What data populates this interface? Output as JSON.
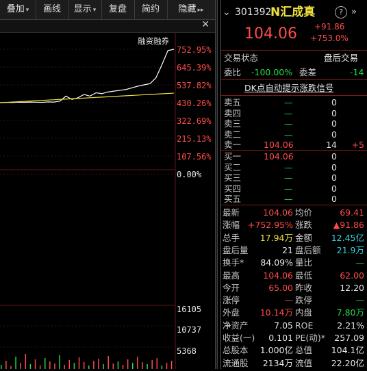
{
  "toolbar": {
    "items": [
      {
        "label": "叠加",
        "caret": "▾"
      },
      {
        "label": "画线",
        "caret": ""
      },
      {
        "label": "显示",
        "caret": "▾"
      },
      {
        "label": "复盘",
        "caret": ""
      },
      {
        "label": "简约",
        "caret": ""
      },
      {
        "label": "隐藏",
        "caret": "▸▸"
      }
    ],
    "close": "✕"
  },
  "chart": {
    "legend": "融资融券",
    "price_labels": [
      "752.95%",
      "645.39%",
      "537.82%",
      "430.26%",
      "322.69%",
      "215.13%",
      "107.56%",
      "0.00%"
    ],
    "volume_labels": [
      "16105",
      "10737",
      "5368"
    ]
  },
  "chart_data": {
    "type": "line",
    "series": [
      {
        "values": [
          430.3,
          432,
          431,
          433,
          432,
          434,
          433,
          432,
          435,
          434,
          440,
          470,
          450,
          460,
          480,
          470,
          490,
          485,
          495,
          500,
          505,
          510,
          520,
          530,
          537.8,
          545,
          580,
          660,
          745,
          752.95
        ]
      },
      {
        "values": [
          430.3,
          432,
          434,
          436,
          438,
          440,
          442,
          444,
          446,
          448,
          450,
          452,
          454,
          456,
          458,
          460,
          462,
          464,
          466,
          468,
          470,
          472,
          474,
          476,
          478,
          480,
          482,
          484,
          486,
          488
        ]
      }
    ],
    "ylim": [
      0,
      752.95
    ]
  },
  "quote": {
    "code": "301392",
    "name": "N汇成真",
    "price": "104.06",
    "change": "+91.86",
    "change_pct": "+753.0%",
    "status_label": "交易状态",
    "status_value": "盘后交易",
    "webi_label": "委比",
    "webi_value": "-100.00%",
    "weicha_label": "委差",
    "weicha_value": "-14",
    "signal": "DK点自动提示涨跌信号"
  },
  "sell_book": [
    {
      "label": "卖五",
      "price": "—",
      "vol": "0",
      "chg": ""
    },
    {
      "label": "卖四",
      "price": "—",
      "vol": "0",
      "chg": ""
    },
    {
      "label": "卖三",
      "price": "—",
      "vol": "0",
      "chg": ""
    },
    {
      "label": "卖二",
      "price": "—",
      "vol": "0",
      "chg": ""
    },
    {
      "label": "卖一",
      "price": "104.06",
      "vol": "14",
      "chg": "+5"
    }
  ],
  "buy_book": [
    {
      "label": "买一",
      "price": "104.06",
      "vol": "0"
    },
    {
      "label": "买二",
      "price": "—",
      "vol": "0"
    },
    {
      "label": "买三",
      "price": "—",
      "vol": "0"
    },
    {
      "label": "买四",
      "price": "—",
      "vol": "0"
    },
    {
      "label": "买五",
      "price": "—",
      "vol": "0"
    }
  ],
  "stats": [
    {
      "l1": "最新",
      "v1": "104.06",
      "c1": "red",
      "l2": "均价",
      "v2": "69.41",
      "c2": "red"
    },
    {
      "l1": "涨幅",
      "v1": "+752.95%",
      "c1": "red",
      "l2": "涨跌",
      "v2": "▲91.86",
      "c2": "red"
    },
    {
      "l1": "总手",
      "v1": "17.94万",
      "c1": "yellow",
      "l2": "金额",
      "v2": "12.45亿",
      "c2": "cyan"
    },
    {
      "l1": "盘后量",
      "v1": "21",
      "c1": "white",
      "l2": "盘后额",
      "v2": "21.9万",
      "c2": "cyan"
    },
    {
      "l1": "换手*",
      "v1": "84.09%",
      "c1": "white",
      "l2": "量比",
      "v2": "—",
      "c2": "green"
    },
    {
      "l1": "最高",
      "v1": "104.06",
      "c1": "red",
      "l2": "最低",
      "v2": "62.00",
      "c2": "red"
    },
    {
      "l1": "今开",
      "v1": "65.00",
      "c1": "red",
      "l2": "昨收",
      "v2": "12.20",
      "c2": "white"
    },
    {
      "l1": "涨停",
      "v1": "—",
      "c1": "red",
      "l2": "跌停",
      "v2": "—",
      "c2": "green"
    },
    {
      "l1": "外盘",
      "v1": "10.14万",
      "c1": "red",
      "l2": "内盘",
      "v2": "7.80万",
      "c2": "green"
    },
    {
      "l1": "净资产",
      "v1": "7.05",
      "c1": "white",
      "l2": "ROE",
      "v2": "2.21%",
      "c2": "white"
    },
    {
      "l1": "收益(一)",
      "v1": "0.101",
      "c1": "white",
      "l2": "PE(动)*",
      "v2": "257.09",
      "c2": "white"
    },
    {
      "l1": "总股本",
      "v1": "1.000亿",
      "c1": "white",
      "l2": "总值",
      "v2": "104.1亿",
      "c2": "white"
    },
    {
      "l1": "流通股",
      "v1": "2134万",
      "c1": "white",
      "l2": "流值",
      "v2": "22.20亿",
      "c2": "white"
    }
  ],
  "icons": {
    "close": "close-icon",
    "dropdown": "chevron-down-icon",
    "help": "help-circle-icon",
    "expand": "double-chevron-right-icon"
  }
}
